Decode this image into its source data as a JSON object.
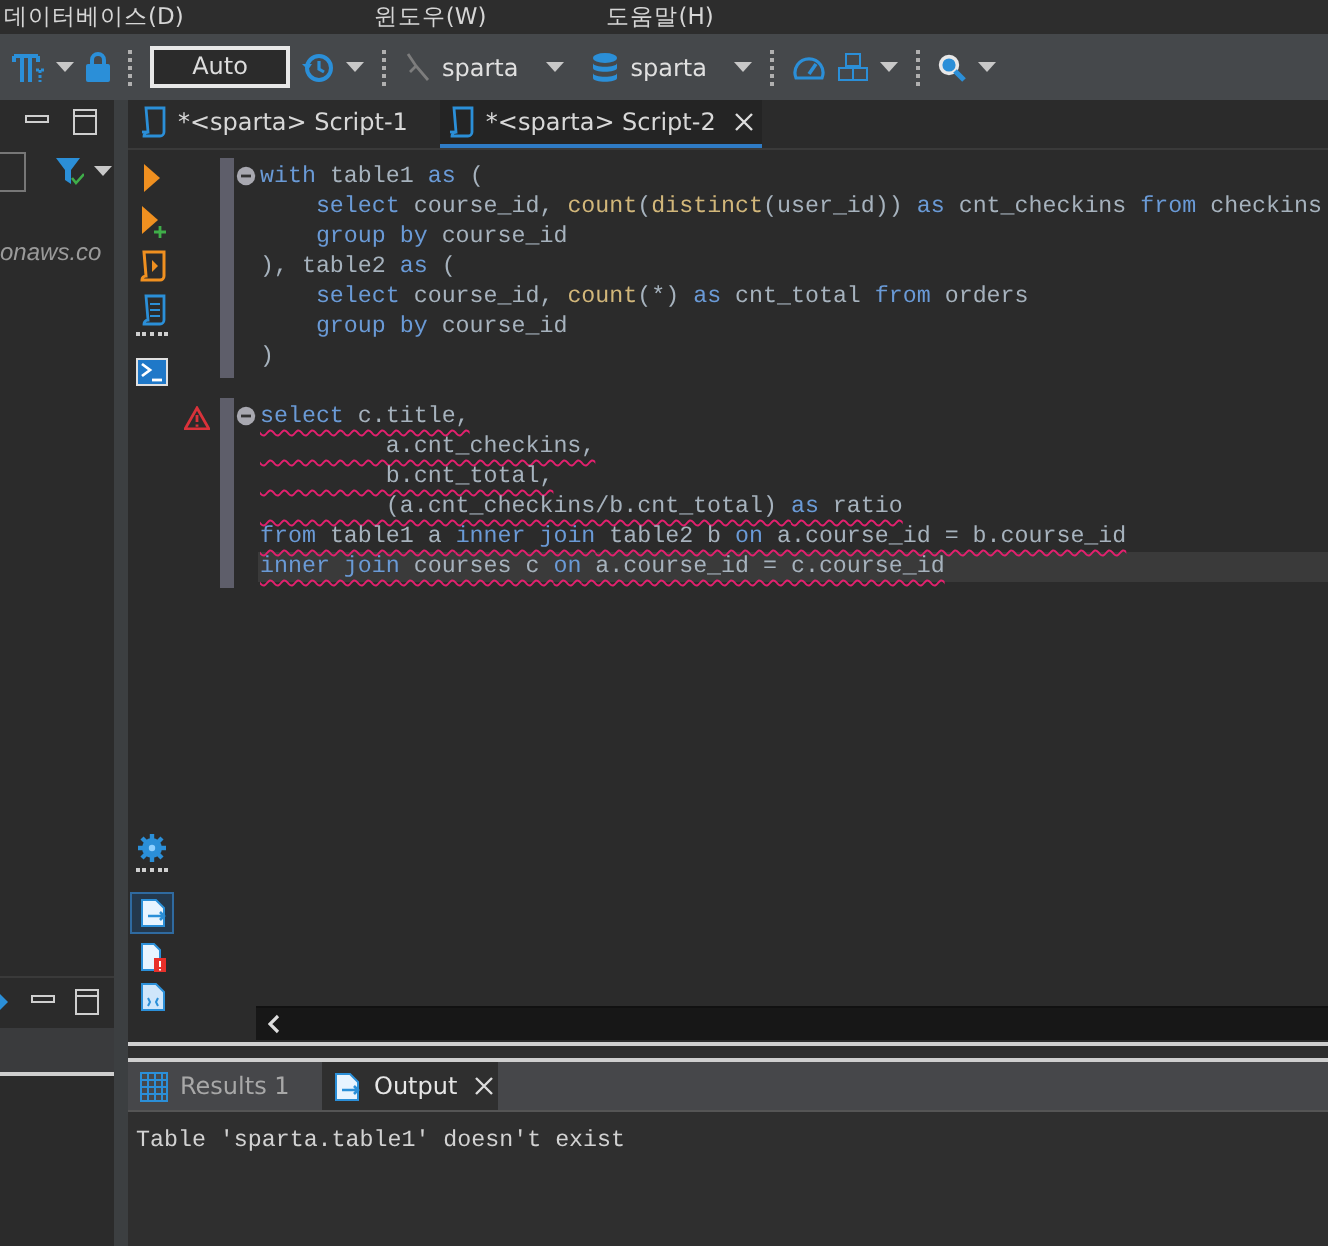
{
  "menu": [
    "데이터베이스(D)",
    "윈도우(W)",
    "도움말(H)"
  ],
  "toolbar": {
    "transaction_mode": "Auto",
    "datasource": "sparta",
    "database": "sparta"
  },
  "navigator": {
    "items": [
      "onaws.co"
    ]
  },
  "editor_tabs": [
    {
      "label": "*<sparta> Script-1",
      "selected": false
    },
    {
      "label": "*<sparta> Script-2",
      "selected": true
    }
  ],
  "code": {
    "blocks": [
      {
        "warning": false,
        "lines": [
          {
            "error": false,
            "current": false,
            "tokens": [
              {
                "kind": "keyword",
                "text": "with"
              },
              {
                "kind": "plain",
                "text": " table1 "
              },
              {
                "kind": "keyword",
                "text": "as"
              },
              {
                "kind": "plain",
                "text": " ("
              }
            ]
          },
          {
            "error": false,
            "current": false,
            "tokens": [
              {
                "kind": "keyword",
                "text": "    select"
              },
              {
                "kind": "plain",
                "text": " course_id, "
              },
              {
                "kind": "function",
                "text": "count"
              },
              {
                "kind": "plain",
                "text": "("
              },
              {
                "kind": "function",
                "text": "distinct"
              },
              {
                "kind": "plain",
                "text": "(user_id)) "
              },
              {
                "kind": "keyword",
                "text": "as"
              },
              {
                "kind": "plain",
                "text": " cnt_checkins "
              },
              {
                "kind": "keyword",
                "text": "from"
              },
              {
                "kind": "plain",
                "text": " checkins"
              }
            ]
          },
          {
            "error": false,
            "current": false,
            "tokens": [
              {
                "kind": "keyword",
                "text": "    group by"
              },
              {
                "kind": "plain",
                "text": " course_id"
              }
            ]
          },
          {
            "error": false,
            "current": false,
            "tokens": [
              {
                "kind": "plain",
                "text": "), table2 "
              },
              {
                "kind": "keyword",
                "text": "as"
              },
              {
                "kind": "plain",
                "text": " ("
              }
            ]
          },
          {
            "error": false,
            "current": false,
            "tokens": [
              {
                "kind": "keyword",
                "text": "    select"
              },
              {
                "kind": "plain",
                "text": " course_id, "
              },
              {
                "kind": "function",
                "text": "count"
              },
              {
                "kind": "plain",
                "text": "(*) "
              },
              {
                "kind": "keyword",
                "text": "as"
              },
              {
                "kind": "plain",
                "text": " cnt_total "
              },
              {
                "kind": "keyword",
                "text": "from"
              },
              {
                "kind": "plain",
                "text": " orders"
              }
            ]
          },
          {
            "error": false,
            "current": false,
            "tokens": [
              {
                "kind": "keyword",
                "text": "    group by"
              },
              {
                "kind": "plain",
                "text": " course_id"
              }
            ]
          },
          {
            "error": false,
            "current": false,
            "tokens": [
              {
                "kind": "plain",
                "text": ")"
              }
            ]
          }
        ]
      },
      {
        "warning": true,
        "lines": [
          {
            "error": true,
            "current": false,
            "tokens": [
              {
                "kind": "keyword",
                "text": "select"
              },
              {
                "kind": "plain",
                "text": " c.title,"
              }
            ]
          },
          {
            "error": true,
            "current": false,
            "tokens": [
              {
                "kind": "plain",
                "text": "         a.cnt_checkins,"
              }
            ]
          },
          {
            "error": true,
            "current": false,
            "tokens": [
              {
                "kind": "plain",
                "text": "         b.cnt_total,"
              }
            ]
          },
          {
            "error": true,
            "current": false,
            "tokens": [
              {
                "kind": "plain",
                "text": "         (a.cnt_checkins/b.cnt_total) "
              },
              {
                "kind": "keyword",
                "text": "as"
              },
              {
                "kind": "plain",
                "text": " ratio"
              }
            ]
          },
          {
            "error": true,
            "current": false,
            "tokens": [
              {
                "kind": "keyword",
                "text": "from"
              },
              {
                "kind": "plain",
                "text": " table1 a "
              },
              {
                "kind": "keyword",
                "text": "inner join"
              },
              {
                "kind": "plain",
                "text": " table2 b "
              },
              {
                "kind": "keyword",
                "text": "on"
              },
              {
                "kind": "plain",
                "text": " a.course_id = b.course_id"
              }
            ]
          },
          {
            "error": true,
            "current": true,
            "tokens": [
              {
                "kind": "keyword",
                "text": "inner join"
              },
              {
                "kind": "plain",
                "text": " courses c "
              },
              {
                "kind": "keyword",
                "text": "on"
              },
              {
                "kind": "plain",
                "text": " a.course_id = c.course_id"
              }
            ]
          }
        ]
      }
    ]
  },
  "result_tabs": [
    {
      "label": "Results 1",
      "selected": false
    },
    {
      "label": "Output",
      "selected": true
    }
  ],
  "output": {
    "text": "Table 'sparta.table1' doesn't exist"
  }
}
